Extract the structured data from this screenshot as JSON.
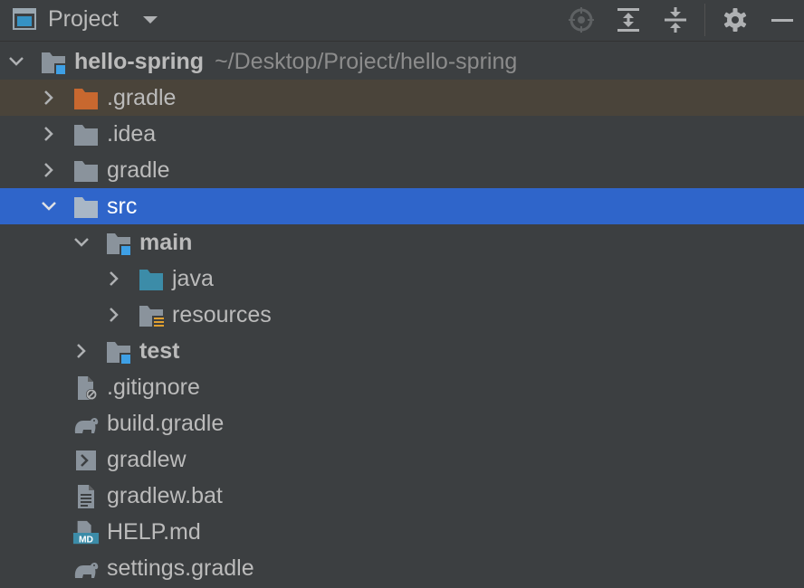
{
  "header": {
    "title": "Project",
    "icons": [
      "project-view-icon",
      "dropdown-icon",
      "locate-icon",
      "expand-all-icon",
      "collapse-all-icon",
      "gear-icon",
      "hide-icon"
    ]
  },
  "tree": {
    "root": {
      "label": "hello-spring",
      "path": "~/Desktop/Project/hello-spring"
    },
    "items": [
      {
        "label": ".gradle"
      },
      {
        "label": ".idea"
      },
      {
        "label": "gradle"
      },
      {
        "label": "src"
      },
      {
        "label": "main"
      },
      {
        "label": "java"
      },
      {
        "label": "resources"
      },
      {
        "label": "test"
      },
      {
        "label": ".gitignore"
      },
      {
        "label": "build.gradle"
      },
      {
        "label": "gradlew"
      },
      {
        "label": "gradlew.bat"
      },
      {
        "label": "HELP.md"
      },
      {
        "label": "settings.gradle"
      }
    ]
  },
  "colors": {
    "background": "#3c3f41",
    "selection": "#2f65ca",
    "gradle_highlight": "#4a443a",
    "folder": "#8a939c",
    "excluded_folder": "#c8682f",
    "source_folder": "#3c8ca8",
    "module_marker": "#3ea0e6"
  }
}
